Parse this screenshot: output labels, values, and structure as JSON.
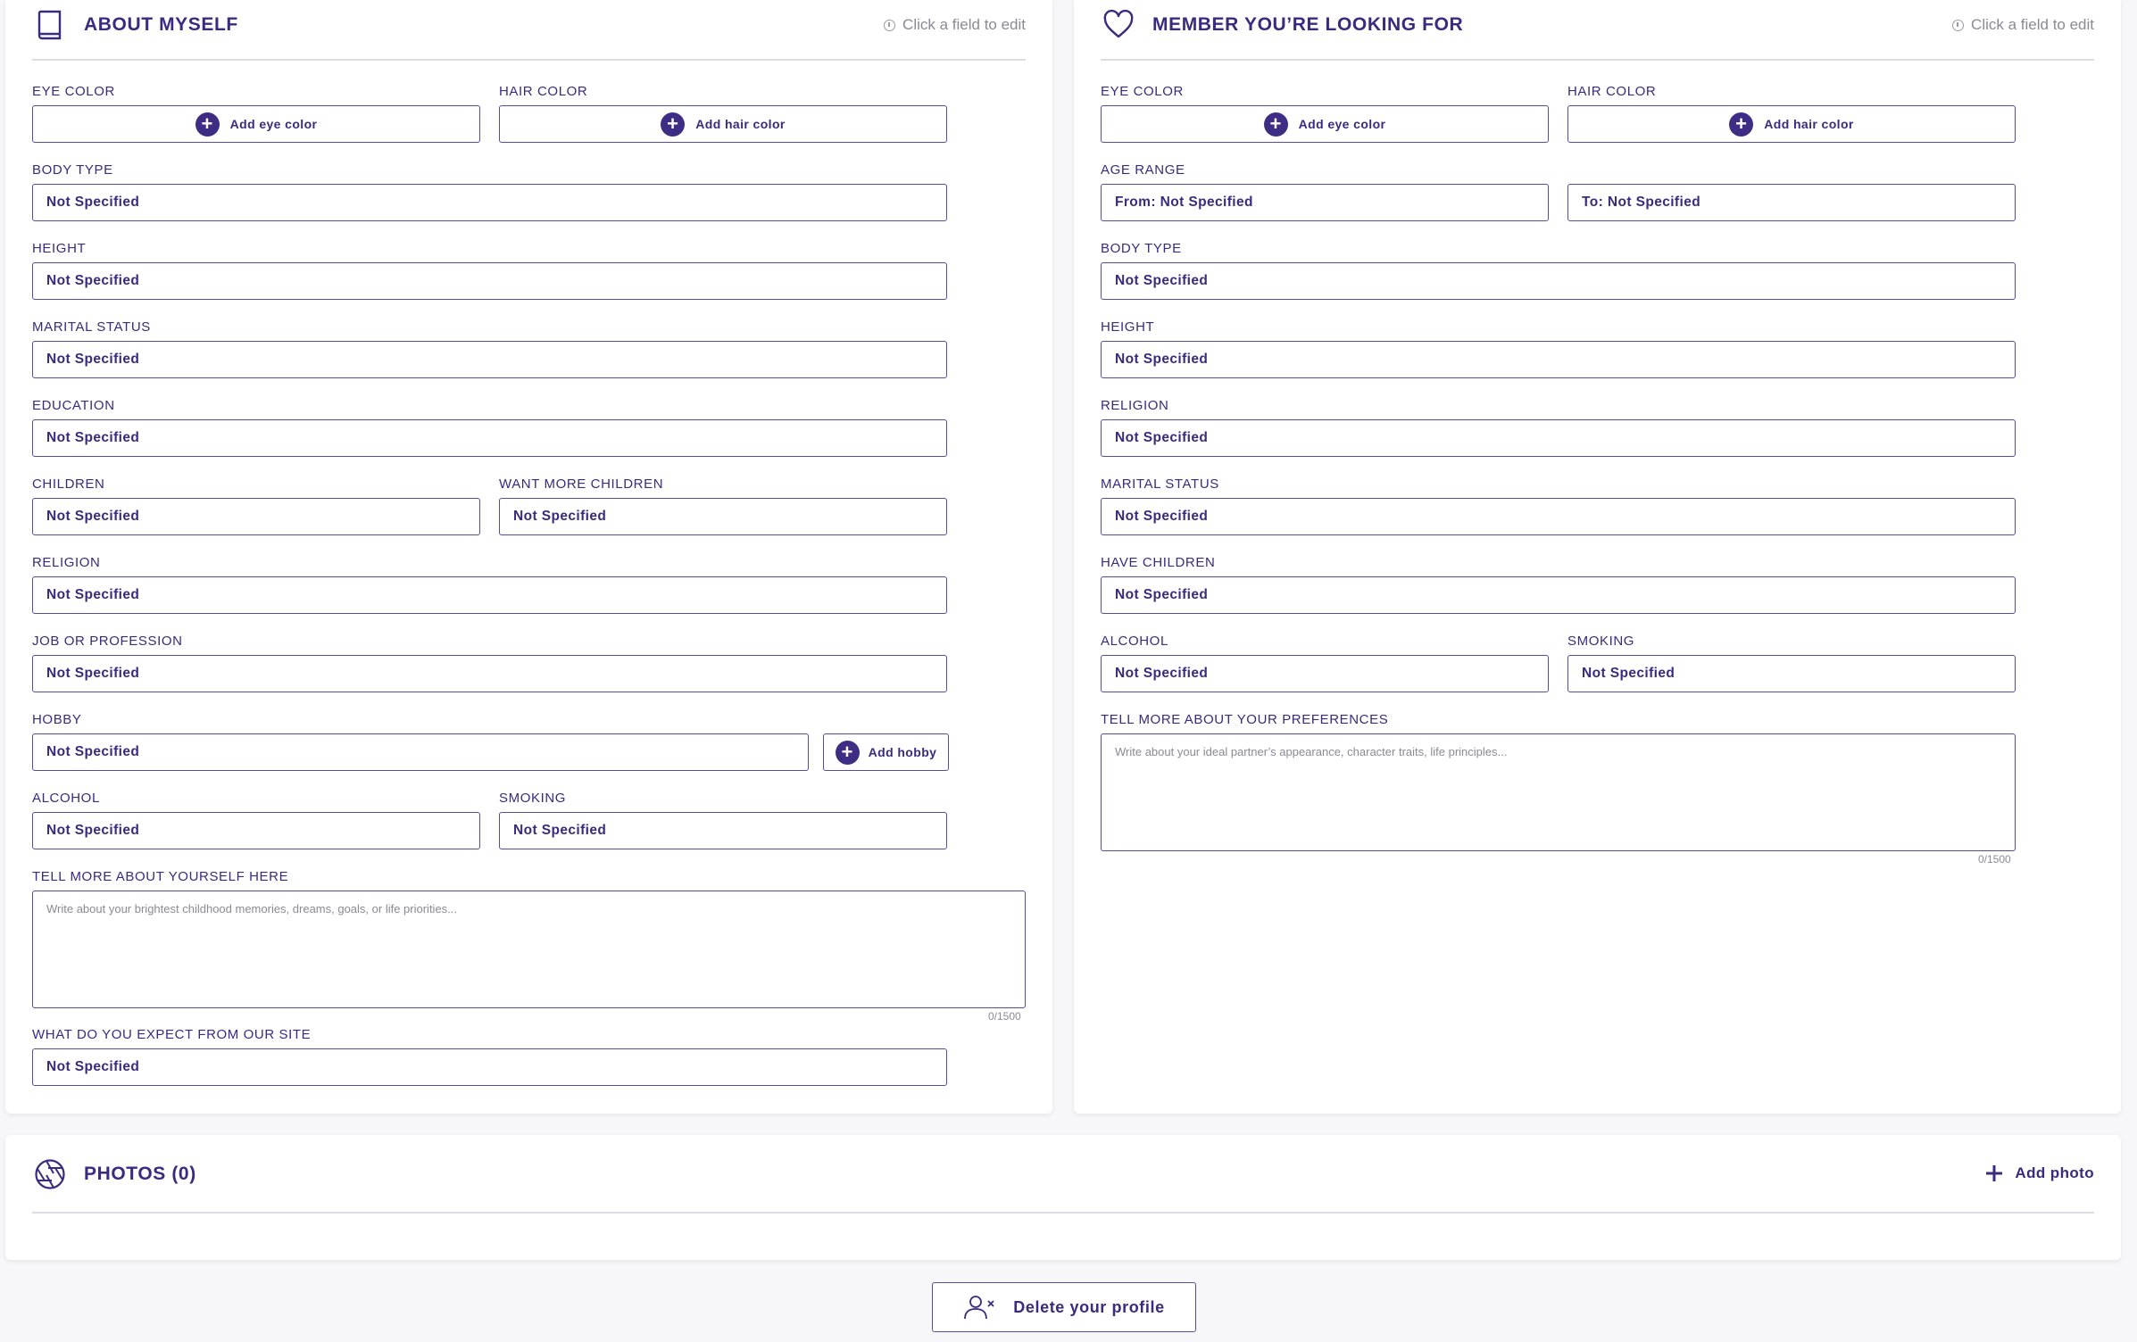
{
  "about": {
    "title": "ABOUT MYSELF",
    "hint": "Click a field to edit",
    "eye_color": {
      "label": "EYE COLOR",
      "button": "Add eye color"
    },
    "hair_color": {
      "label": "HAIR COLOR",
      "button": "Add hair color"
    },
    "body_type": {
      "label": "BODY TYPE",
      "value": "Not Specified"
    },
    "height": {
      "label": "HEIGHT",
      "value": "Not Specified"
    },
    "marital_status": {
      "label": "MARITAL STATUS",
      "value": "Not Specified"
    },
    "education": {
      "label": "EDUCATION",
      "value": "Not Specified"
    },
    "children": {
      "label": "CHILDREN",
      "value": "Not Specified"
    },
    "want_more_children": {
      "label": "WANT MORE CHILDREN",
      "value": "Not Specified"
    },
    "religion": {
      "label": "RELIGION",
      "value": "Not Specified"
    },
    "job": {
      "label": "JOB OR PROFESSION",
      "value": "Not Specified"
    },
    "hobby": {
      "label": "HOBBY",
      "value": "Not Specified",
      "button": "Add hobby"
    },
    "alcohol": {
      "label": "ALCOHOL",
      "value": "Not Specified"
    },
    "smoking": {
      "label": "SMOKING",
      "value": "Not Specified"
    },
    "tell_more": {
      "label": "TELL MORE ABOUT YOURSELF HERE",
      "placeholder": "Write about your brightest childhood memories, dreams, goals, or life priorities...",
      "counter": "0/1500"
    },
    "expect": {
      "label": "WHAT DO YOU EXPECT FROM OUR SITE",
      "value": "Not Specified"
    }
  },
  "looking": {
    "title": "MEMBER YOU’RE LOOKING FOR",
    "hint": "Click a field to edit",
    "eye_color": {
      "label": "EYE COLOR",
      "button": "Add eye color"
    },
    "hair_color": {
      "label": "HAIR COLOR",
      "button": "Add hair color"
    },
    "age_range": {
      "label": "AGE RANGE",
      "from": "From: Not Specified",
      "to": "To: Not Specified"
    },
    "body_type": {
      "label": "BODY TYPE",
      "value": "Not Specified"
    },
    "height": {
      "label": "HEIGHT",
      "value": "Not Specified"
    },
    "religion": {
      "label": "RELIGION",
      "value": "Not Specified"
    },
    "marital_status": {
      "label": "MARITAL STATUS",
      "value": "Not Specified"
    },
    "have_children": {
      "label": "HAVE CHILDREN",
      "value": "Not Specified"
    },
    "alcohol": {
      "label": "ALCOHOL",
      "value": "Not Specified"
    },
    "smoking": {
      "label": "SMOKING",
      "value": "Not Specified"
    },
    "preferences": {
      "label": "TELL MORE ABOUT YOUR PREFERENCES",
      "placeholder": "Write about your ideal partner’s appearance, character traits, life principles...",
      "counter": "0/1500"
    }
  },
  "photos": {
    "title": "PHOTOS (0)",
    "add_label": "Add photo"
  },
  "delete_label": "Delete your profile",
  "colors": {
    "accent": "#3b2a7e",
    "border": "#5a4b99",
    "muted": "#8a8a96",
    "background": "#f7f7f9"
  }
}
